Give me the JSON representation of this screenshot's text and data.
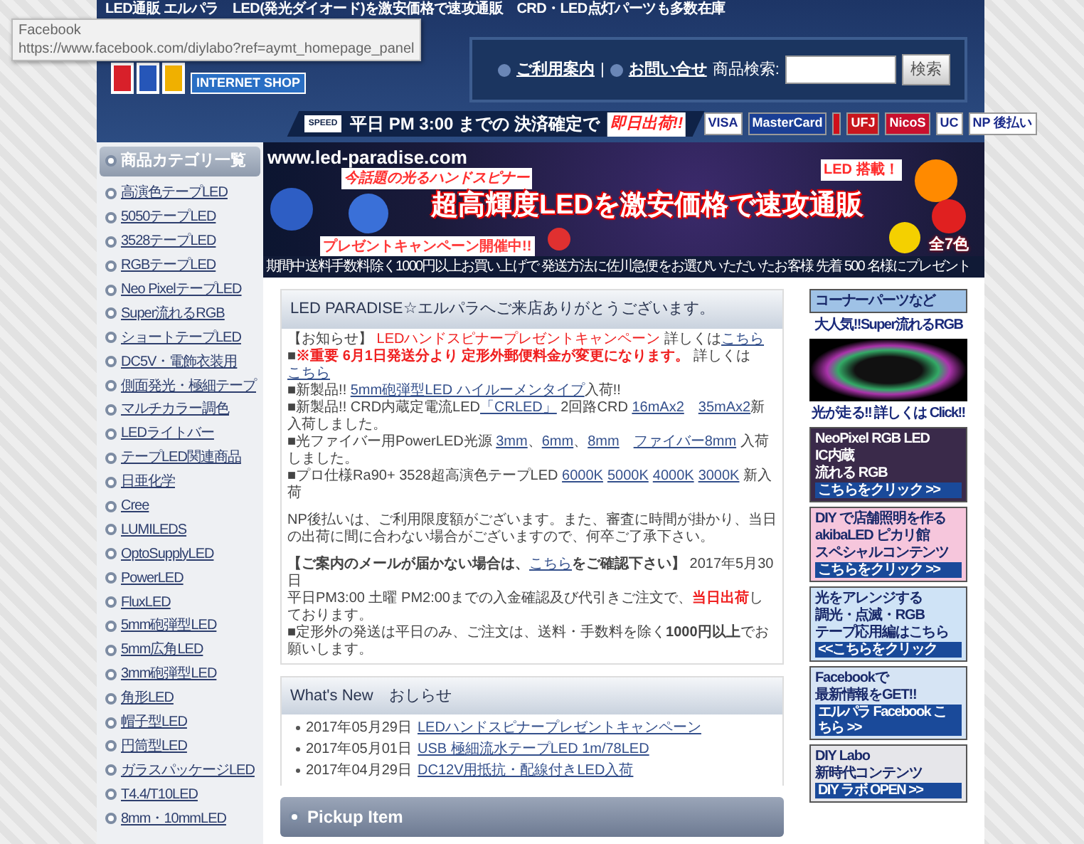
{
  "tooltip": {
    "title": "Facebook",
    "url": "https://www.facebook.com/diylabo?ref=aymt_homepage_panel"
  },
  "header": {
    "tagline": "LED通販 エルパラ　LED(発光ダイオード)を激安価格で速攻通販　CRD・LED点灯パーツも多数在庫",
    "logo_sub": "INTERNET SHOP",
    "nav": [
      {
        "label": "ご利用案内"
      },
      {
        "label": "お問い合せ"
      }
    ],
    "nav_divider": "|",
    "search": {
      "label": "商品検索:",
      "button": "検索"
    },
    "shipping": {
      "badge": "SPEED",
      "text": "平日 PM 3:00 までの 決済確定で",
      "highlight": "即日出荷!!"
    },
    "payments": [
      {
        "kind": "text",
        "label": "VISA",
        "color": "#ffffff"
      },
      {
        "kind": "text",
        "label": "MasterCard",
        "color": "#1b3f95"
      },
      {
        "kind": "mark",
        "color": "#d0101a"
      },
      {
        "kind": "text",
        "label": "UFJ",
        "color": "#c8161d"
      },
      {
        "kind": "text",
        "label": "NicoS",
        "color": "#c8102e"
      },
      {
        "kind": "text",
        "label": "UC",
        "color": "#ffffff"
      },
      {
        "kind": "text",
        "label": "NP 後払い",
        "color": "#ffffff"
      }
    ]
  },
  "sidebar": {
    "title": "商品カテゴリ一覧",
    "items": [
      "高演色テープLED",
      "5050テープLED",
      "3528テープLED",
      "RGBテープLED",
      "Neo PixelテープLED",
      "Super流れるRGB",
      "ショートテープLED",
      "DC5V・電飾衣装用",
      "側面発光・極細テープ",
      "マルチカラー調色",
      "LEDライトバー",
      "テープLED関連商品",
      "日亜化学",
      "Cree",
      "LUMILEDS",
      "OptoSupplyLED",
      "PowerLED",
      "FluxLED",
      "5mm砲弾型LED",
      "5mm広角LED",
      "3mm砲弾型LED",
      "角形LED",
      "帽子型LED",
      "円筒型LED",
      "ガラスパッケージLED",
      "T4.4/T10LED",
      "8mm・10mmLED"
    ]
  },
  "hero": {
    "site": "www.led-paradise.com",
    "kicker": "今話題の光るハンドスピナー",
    "headline": "超高輝度LEDを激安価格で速攻通販",
    "badge": "LED 搭載！",
    "campaign": "プレゼントキャンペーン開催中!!",
    "colors": "全7色",
    "footer": "期間中送料手数料除く1000円以上お買い上げで 発送方法に佐川急便をお選びいただいたお客様 先着 500 名様にプレゼント"
  },
  "welcome": {
    "title": "LED PARADISE☆エルパラへご来店ありがとうございます。",
    "paragraphs": [
      [
        {
          "kind": "text",
          "text": "【お知らせ】 "
        },
        {
          "kind": "red",
          "text": "LEDハンドスピナープレゼントキャンペーン"
        },
        {
          "kind": "text",
          "text": " 詳しくは"
        },
        {
          "kind": "link",
          "text": "こちら"
        }
      ],
      [
        {
          "kind": "text",
          "text": "■"
        },
        {
          "kind": "redbold",
          "text": "※重要 6月1日発送分より 定形外郵便料金が変更になります。"
        },
        {
          "kind": "text",
          "text": " 詳しくは"
        },
        {
          "kind": "link",
          "text": "こちら"
        }
      ],
      [
        {
          "kind": "text",
          "text": "■新製品!! "
        },
        {
          "kind": "link",
          "text": "5mm砲弾型LED ハイルーメンタイプ"
        },
        {
          "kind": "text",
          "text": "入荷!!"
        }
      ],
      [
        {
          "kind": "text",
          "text": "■新製品!! CRD内蔵定電流LED"
        },
        {
          "kind": "link",
          "text": "「CRLED」"
        },
        {
          "kind": "text",
          "text": " 2回路CRD "
        },
        {
          "kind": "link",
          "text": "16mAx2"
        },
        {
          "kind": "space"
        },
        {
          "kind": "link",
          "text": "35mAx2"
        },
        {
          "kind": "text",
          "text": "新入荷しました。"
        }
      ],
      [
        {
          "kind": "text",
          "text": "■光ファイバー用PowerLED光源 "
        },
        {
          "kind": "link",
          "text": "3mm"
        },
        {
          "kind": "text",
          "text": "、"
        },
        {
          "kind": "link",
          "text": "6mm"
        },
        {
          "kind": "text",
          "text": "、"
        },
        {
          "kind": "link",
          "text": "8mm"
        },
        {
          "kind": "space"
        },
        {
          "kind": "link",
          "text": "ファイバー8mm"
        },
        {
          "kind": "text",
          "text": " 入荷しました。"
        }
      ],
      [
        {
          "kind": "text",
          "text": "■プロ仕様Ra90+ 3528超高演色テープLED "
        },
        {
          "kind": "link",
          "text": "6000K"
        },
        {
          "kind": "thin"
        },
        {
          "kind": "link",
          "text": "5000K"
        },
        {
          "kind": "thin"
        },
        {
          "kind": "link",
          "text": "4000K"
        },
        {
          "kind": "thin"
        },
        {
          "kind": "link",
          "text": "3000K"
        },
        {
          "kind": "text",
          "text": " 新入荷"
        }
      ],
      [
        {
          "kind": "gap"
        }
      ],
      [
        {
          "kind": "text",
          "text": "NP後払いは、ご利用限度額がございます。また、審査に時間が掛かり、当日の出荷に間に合わない場合がございますので、何卒ご了承下さい。"
        }
      ],
      [
        {
          "kind": "gap"
        }
      ],
      [
        {
          "kind": "bold",
          "text": "【ご案内のメールが届かない場合は、"
        },
        {
          "kind": "link",
          "text": "こちら"
        },
        {
          "kind": "bold",
          "text": "をご確認下さい】"
        },
        {
          "kind": "text",
          "text": " 2017年5月30日"
        }
      ],
      [
        {
          "kind": "text",
          "text": "平日PM3:00 土曜 PM2:00までの入金確認及び代引きご注文で、"
        },
        {
          "kind": "redbold",
          "text": "当日出荷"
        },
        {
          "kind": "text",
          "text": "しております。"
        }
      ],
      [
        {
          "kind": "text",
          "text": "■定形外の発送は平日のみ、ご注文は、送料・手数料を除く"
        },
        {
          "kind": "bold",
          "text": "1000円以上"
        },
        {
          "kind": "text",
          "text": "でお願いします。"
        }
      ]
    ]
  },
  "news": {
    "title": "What's New　おしらせ",
    "items": [
      {
        "date": "2017年05月29日",
        "title": "LEDハンドスピナープレゼントキャンペーン"
      },
      {
        "date": "2017年05月01日",
        "title": "USB 極細流水テープLED 1m/78LED"
      },
      {
        "date": "2017年04月29日",
        "title": "DC12V用抵抗・配線付きLED入荷"
      }
    ]
  },
  "pickup": {
    "title": "Pickup Item"
  },
  "promos": [
    {
      "kind": "ad",
      "color": "#9fc2e6",
      "lines": [
        "コーナーパーツなど"
      ]
    },
    {
      "kind": "caption",
      "lines": [
        "大人気!!Super流れるRGB"
      ]
    },
    {
      "kind": "photo"
    },
    {
      "kind": "caption",
      "lines": [
        "光が走る!! 詳しくは Click!!"
      ]
    },
    {
      "kind": "ad",
      "color": "#3a2a4a",
      "lines": [
        "NeoPixel RGB LED",
        "IC内蔵",
        "流れる RGB"
      ],
      "cta": "こちらをクリック >>"
    },
    {
      "kind": "ad",
      "color": "#f6c6dc",
      "lines": [
        "DIY で店舗照明を作る",
        "akibaLED ピカリ館",
        "スペシャルコンテンツ"
      ],
      "cta": "こちらをクリック >>"
    },
    {
      "kind": "ad",
      "color": "#cfe3f6",
      "lines": [
        "光をアレンジする",
        "調光・点滅・RGB",
        "テープ応用編はこちら"
      ],
      "cta": "<<こちらをクリック"
    },
    {
      "kind": "ad",
      "color": "#d6e4f4",
      "lines": [
        "Facebookで",
        "最新情報をGET!!"
      ],
      "cta": "エルパラ Facebook こちら >>"
    },
    {
      "kind": "ad",
      "color": "#e6e6ea",
      "lines": [
        "DIY Labo",
        "新時代コンテンツ"
      ],
      "cta": "DIY ラボ OPEN >>"
    }
  ]
}
